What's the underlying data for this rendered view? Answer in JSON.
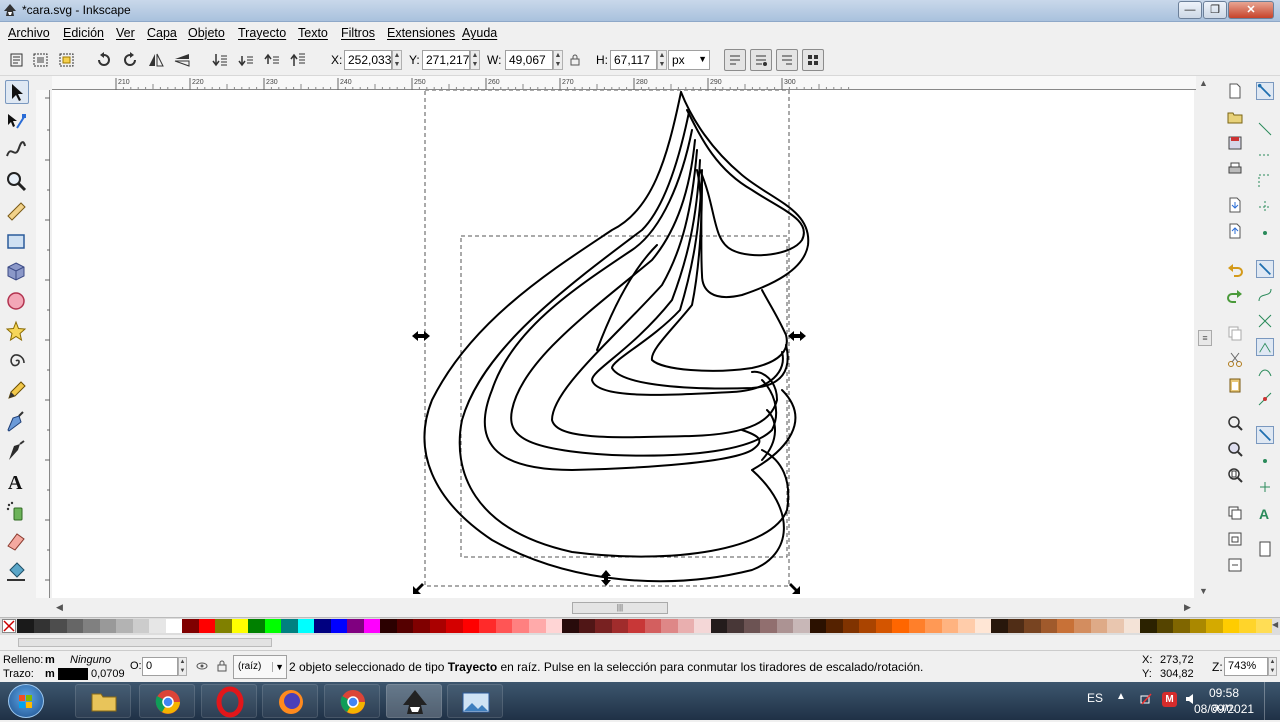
{
  "window": {
    "title": "*cara.svg - Inkscape"
  },
  "menu": [
    "Archivo",
    "Edición",
    "Ver",
    "Capa",
    "Objeto",
    "Trayecto",
    "Texto",
    "Filtros",
    "Extensiones",
    "Ayuda"
  ],
  "toolbar": {
    "x_label": "X:",
    "x_value": "252,033",
    "y_label": "Y:",
    "y_value": "271,217",
    "w_label": "W:",
    "w_value": "49,067",
    "h_label": "H:",
    "h_value": "67,117",
    "unit": "px"
  },
  "ruler": {
    "ticks": [
      "210",
      "220",
      "230",
      "240",
      "250",
      "260",
      "270",
      "280",
      "290",
      "300"
    ]
  },
  "tools": [
    "selector-tool",
    "node-tool",
    "tweak-tool",
    "zoom-tool",
    "measure-tool",
    "rectangle-tool",
    "box3d-tool",
    "ellipse-tool",
    "star-tool",
    "spiral-tool",
    "pencil-tool",
    "pen-tool",
    "calligraphy-tool",
    "text-tool",
    "spray-tool",
    "eraser-tool",
    "paint-bucket-tool"
  ],
  "palette": [
    "#1a1a1a",
    "#333333",
    "#4d4d4d",
    "#666666",
    "#808080",
    "#999999",
    "#b3b3b3",
    "#cccccc",
    "#e6e6e6",
    "#ffffff",
    "#800000",
    "#ff0000",
    "#808000",
    "#ffff00",
    "#008000",
    "#00ff00",
    "#008080",
    "#00ffff",
    "#000080",
    "#0000ff",
    "#800080",
    "#ff00ff",
    "#2b0000",
    "#550000",
    "#800000",
    "#aa0000",
    "#d40000",
    "#ff0000",
    "#ff2a2a",
    "#ff5555",
    "#ff8080",
    "#ffaaaa",
    "#ffd5d5",
    "#280b0b",
    "#501616",
    "#782121",
    "#a02c2c",
    "#c83737",
    "#d35f5f",
    "#de8787",
    "#e9afaf",
    "#f4d7d7",
    "#241c1c",
    "#483737",
    "#6c5353",
    "#916f6f",
    "#ac9393",
    "#c8b7b7",
    "#2b1100",
    "#552200",
    "#803300",
    "#aa4400",
    "#d45500",
    "#ff6600",
    "#ff7f2a",
    "#ff9955",
    "#ffb380",
    "#ffccaa",
    "#ffe6d5",
    "#28170b",
    "#502d16",
    "#784421",
    "#a05a2c",
    "#c87137",
    "#d38d5f",
    "#deaa87",
    "#e9c6af",
    "#f4e3d7",
    "#2b2200",
    "#554400",
    "#806600",
    "#aa8800",
    "#d4aa00",
    "#ffcc00",
    "#ffd42a",
    "#ffdd55"
  ],
  "status": {
    "fill_label": "Relleno:",
    "fill_value": "m",
    "fill_none": "Ninguno",
    "stroke_label": "Trazo:",
    "stroke_value": "m",
    "stroke_width": "0,0709",
    "opacity_label": "O:",
    "opacity_value": "0",
    "layer": "(raíz)",
    "message_pre": "2 objeto seleccionado de tipo ",
    "message_bold": "Trayecto",
    "message_post": " en raíz. Pulse en la selección para conmutar los tiradores de escalado/rotación.",
    "cursor_x_label": "X:",
    "cursor_x": "273,72",
    "cursor_y_label": "Y:",
    "cursor_y": "304,82",
    "zoom_label": "Z:",
    "zoom": "743%"
  },
  "taskbar": {
    "language": "ES",
    "time": "09:58 a.m.",
    "date": "08/09/2021"
  },
  "colors": {
    "accent": "#3d566e",
    "close": "#c7432a"
  }
}
